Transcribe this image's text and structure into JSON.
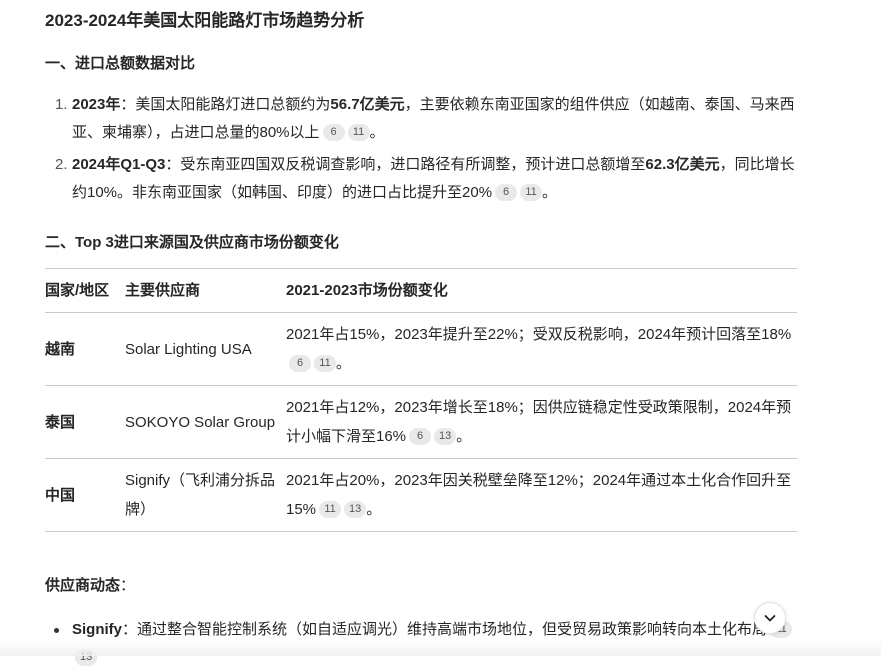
{
  "title": "2023-2024年美国太阳能路灯市场趋势分析",
  "section1": {
    "heading": "一、进口总额数据对比",
    "items": [
      {
        "num": "1.",
        "label": "2023年",
        "pre": "：美国太阳能路灯进口总额约为",
        "highlight": "56.7亿美元",
        "post": "，主要依赖东南亚国家的组件供应（如越南、泰国、马来西亚、柬埔寨），占进口总量的80%以上",
        "cites": [
          "6",
          "11"
        ]
      },
      {
        "num": "2.",
        "label": "2024年Q1-Q3",
        "pre": "：受东南亚四国双反税调查影响，进口路径有所调整，预计进口总额增至",
        "highlight": "62.3亿美元",
        "post": "，同比增长约10%。非东南亚国家（如韩国、印度）的进口占比提升至20%",
        "cites": [
          "6",
          "11"
        ]
      }
    ]
  },
  "section2": {
    "heading": "二、Top 3进口来源国及供应商市场份额变化",
    "table": {
      "headers": [
        "国家/地区",
        "主要供应商",
        "2021-2023市场份额变化"
      ],
      "rows": [
        {
          "country": "越南",
          "supplier": "Solar Lighting USA",
          "change": "2021年占15%，2023年提升至22%；受双反税影响，2024年预计回落至18%",
          "cites": [
            "6",
            "11"
          ]
        },
        {
          "country": "泰国",
          "supplier": "SOKOYO Solar Group",
          "change": "2021年占12%，2023年增长至18%；因供应链稳定性受政策限制，2024年预计小幅下滑至16%",
          "cites": [
            "6",
            "13"
          ]
        },
        {
          "country": "中国",
          "supplier": "Signify（飞利浦分拆品牌）",
          "change": "2021年占20%，2023年因关税壁垒降至12%；2024年通过本土化合作回升至15%",
          "cites": [
            "11",
            "13"
          ]
        }
      ]
    }
  },
  "dynamics": {
    "label": "供应商动态",
    "colon": "：",
    "items": [
      {
        "name": "Signify",
        "text": "：通过整合智能控制系统（如自适应调光）维持高端市场地位，但受贸易政策影响转向本土化布局",
        "cites": [
          "11",
          "13"
        ]
      }
    ]
  },
  "scroll_button": {
    "icon": "chevron-down-icon"
  }
}
